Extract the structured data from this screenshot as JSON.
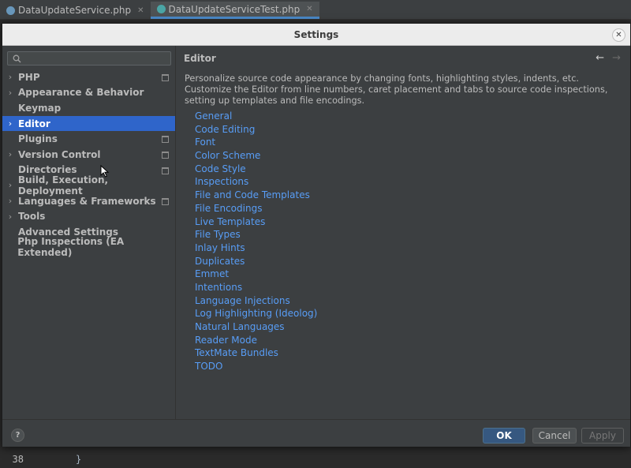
{
  "ide": {
    "tabs": [
      {
        "label": "DataUpdateService.php",
        "active": false
      },
      {
        "label": "DataUpdateServiceTest.php",
        "active": true
      }
    ],
    "line_number": "38",
    "line_code": "}"
  },
  "dialog": {
    "title": "Settings",
    "close_icon": "close-icon",
    "search": {
      "placeholder": "",
      "value": "",
      "icon": "search-icon"
    },
    "tree": [
      {
        "label": "PHP",
        "has_children": true,
        "project_icon": true,
        "selected": false
      },
      {
        "label": "Appearance & Behavior",
        "has_children": true,
        "project_icon": false,
        "selected": false
      },
      {
        "label": "Keymap",
        "has_children": false,
        "project_icon": false,
        "selected": false
      },
      {
        "label": "Editor",
        "has_children": true,
        "project_icon": false,
        "selected": true
      },
      {
        "label": "Plugins",
        "has_children": false,
        "project_icon": true,
        "selected": false
      },
      {
        "label": "Version Control",
        "has_children": true,
        "project_icon": true,
        "selected": false
      },
      {
        "label": "Directories",
        "has_children": false,
        "project_icon": true,
        "selected": false
      },
      {
        "label": "Build, Execution, Deployment",
        "has_children": true,
        "project_icon": false,
        "selected": false
      },
      {
        "label": "Languages & Frameworks",
        "has_children": true,
        "project_icon": true,
        "selected": false
      },
      {
        "label": "Tools",
        "has_children": true,
        "project_icon": false,
        "selected": false
      },
      {
        "label": "Advanced Settings",
        "has_children": false,
        "project_icon": false,
        "selected": false
      },
      {
        "label": "Php Inspections (EA Extended)",
        "has_children": false,
        "project_icon": false,
        "selected": false
      }
    ],
    "panel": {
      "title": "Editor",
      "back_icon": "arrow-left-icon",
      "forward_icon": "arrow-right-icon",
      "description": "Personalize source code appearance by changing fonts, highlighting styles, indents, etc. Customize the Editor from line numbers, caret placement and tabs to source code inspections, setting up templates and file encodings.",
      "links": [
        "General",
        "Code Editing",
        "Font",
        "Color Scheme",
        "Code Style",
        "Inspections",
        "File and Code Templates",
        "File Encodings",
        "Live Templates",
        "File Types",
        "Inlay Hints",
        "Duplicates",
        "Emmet",
        "Intentions",
        "Language Injections",
        "Log Highlighting (Ideolog)",
        "Natural Languages",
        "Reader Mode",
        "TextMate Bundles",
        "TODO"
      ]
    },
    "footer": {
      "help_label": "?",
      "ok_label": "OK",
      "cancel_label": "Cancel",
      "apply_label": "Apply"
    }
  },
  "colors": {
    "accent_selection": "#2f65ca",
    "link": "#589df6",
    "dialog_bg": "#3c3f41",
    "ok_button": "#365880"
  }
}
